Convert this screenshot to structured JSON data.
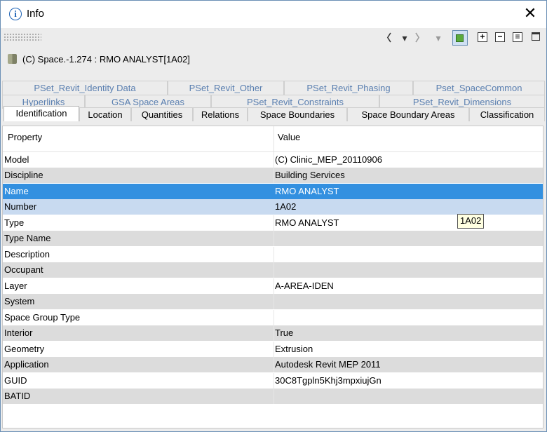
{
  "window": {
    "title": "Info",
    "close_glyph": "✕"
  },
  "toolbar": {
    "back_glyph": "〈",
    "dropdown_glyph": "▾",
    "forward_glyph": "〉",
    "plus_glyph": "+",
    "minus_glyph": "−",
    "collapse_glyph": "≡"
  },
  "breadcrumb": "(C) Space.-1.274 : RMO ANALYST[1A02]",
  "tabs_row1": [
    "PSet_Revit_Identity Data",
    "PSet_Revit_Other",
    "PSet_Revit_Phasing",
    "Pset_SpaceCommon"
  ],
  "tabs_row2": [
    "Hyperlinks",
    "GSA Space Areas",
    "PSet_Revit_Constraints",
    "PSet_Revit_Dimensions"
  ],
  "tabs_row3": [
    "Identification",
    "Location",
    "Quantities",
    "Relations",
    "Space Boundaries",
    "Space Boundary Areas",
    "Classification"
  ],
  "active_tab": "Identification",
  "table": {
    "headers": [
      "Property",
      "Value"
    ],
    "rows": [
      {
        "property": "Model",
        "value": "(C) Clinic_MEP_20110906"
      },
      {
        "property": "Discipline",
        "value": "Building Services"
      },
      {
        "property": "Name",
        "value": "RMO ANALYST"
      },
      {
        "property": "Number",
        "value": "1A02"
      },
      {
        "property": "Type",
        "value": "RMO ANALYST"
      },
      {
        "property": "Type Name",
        "value": ""
      },
      {
        "property": "Description",
        "value": ""
      },
      {
        "property": "Occupant",
        "value": ""
      },
      {
        "property": "Layer",
        "value": "A-AREA-IDEN"
      },
      {
        "property": "System",
        "value": ""
      },
      {
        "property": "Space Group Type",
        "value": ""
      },
      {
        "property": "Interior",
        "value": "True"
      },
      {
        "property": "Geometry",
        "value": "Extrusion"
      },
      {
        "property": "Application",
        "value": "Autodesk Revit MEP 2011"
      },
      {
        "property": "GUID",
        "value": "30C8Tgpln5Khj3mpxiujGn"
      },
      {
        "property": "BATID",
        "value": ""
      }
    ],
    "selected_row": "Name",
    "highlighted_row": "Number"
  },
  "tooltip": "1A02",
  "colors": {
    "selection": "#3390e0",
    "hover": "#c8daf0",
    "tab_text": "#5a7fb0"
  }
}
